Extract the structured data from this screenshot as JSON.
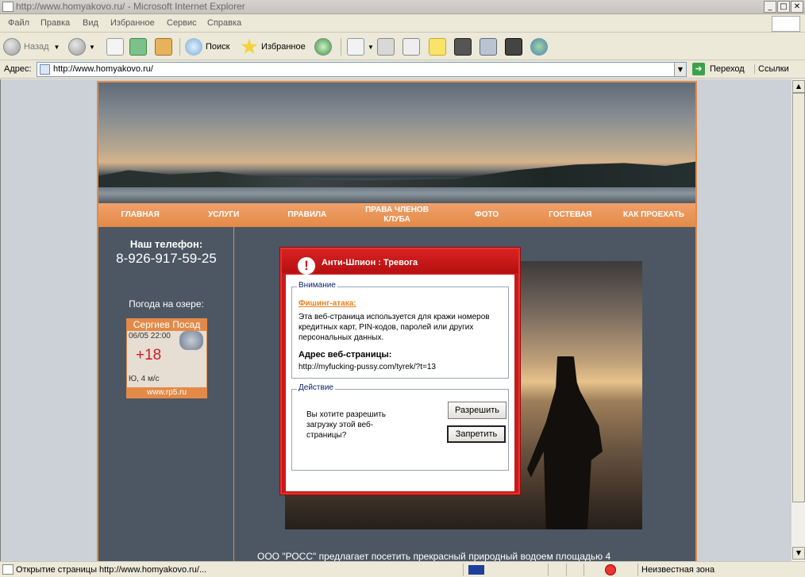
{
  "window": {
    "title": "http://www.homyakovo.ru/ - Microsoft Internet Explorer"
  },
  "menu": [
    "Файл",
    "Правка",
    "Вид",
    "Избранное",
    "Сервис",
    "Справка"
  ],
  "toolbar": {
    "back_label": "Назад",
    "search_label": "Поиск",
    "favorites_label": "Избранное"
  },
  "address": {
    "label": "Адрес:",
    "url": "http://www.homyakovo.ru/",
    "go_label": "Переход",
    "links_label": "Ссылки"
  },
  "site": {
    "nav": [
      "ГЛАВНАЯ",
      "УСЛУГИ",
      "ПРАВИЛА",
      "ПРАВА ЧЛЕНОВ КЛУБА",
      "ФОТО",
      "ГОСТЕВАЯ",
      "КАК ПРОЕХАТЬ"
    ],
    "phone_label": "Наш телефон:",
    "phone_number": "8-926-917-59-25",
    "weather_label": "Погода на озере:",
    "weather": {
      "city": "Сергиев Посад",
      "datetime": "06/05 22:00",
      "temp": "+18",
      "wind": "Ю, 4 м/с",
      "source": "www.rp5.ru"
    },
    "bottom_text": "ООО \"РОСС\" предлагает посетить прекрасный природный водоем площадью 4"
  },
  "dialog": {
    "title": "Анти-Шпион : Тревога",
    "group_attention": "Внимание",
    "threat_link": "Фишинг-атака:",
    "threat_text": "Эта веб-страница используется для кражи номеров кредитных карт, PIN-кодов, паролей или других персональных данных.",
    "address_label": "Адрес веб-страницы:",
    "address_value": "http://myfucking-pussy.com/tyrek/?t=13",
    "group_action": "Действие",
    "question": "Вы хотите разрешить загрузку этой веб-страницы?",
    "allow_label": "Разрешить",
    "deny_label": "Запретить"
  },
  "status": {
    "text": "Открытие страницы http://www.homyakovo.ru/...",
    "zone": "Неизвестная зона"
  }
}
